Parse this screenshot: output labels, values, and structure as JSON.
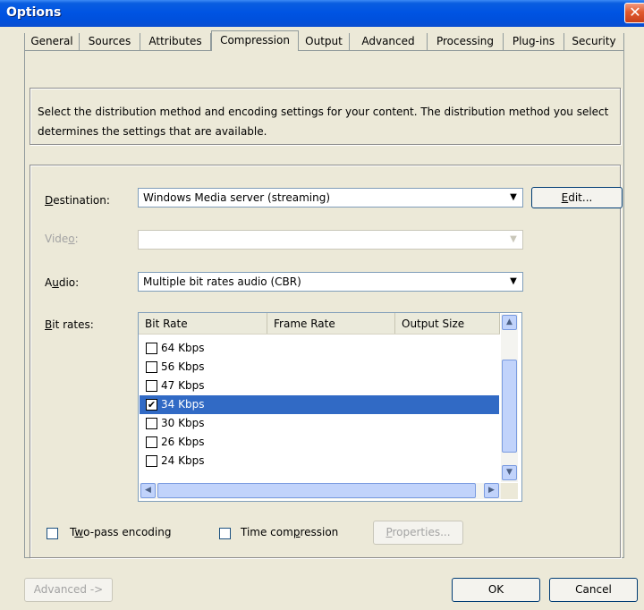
{
  "window": {
    "title": "Options",
    "close_glyph": "✕"
  },
  "tabs": [
    {
      "label": "General",
      "active": false
    },
    {
      "label": "Sources",
      "active": false
    },
    {
      "label": "Attributes",
      "active": false
    },
    {
      "label": "Compression",
      "active": true
    },
    {
      "label": "Output",
      "active": false
    },
    {
      "label": "Advanced",
      "active": false
    },
    {
      "label": "Processing",
      "active": false
    },
    {
      "label": "Plug-ins",
      "active": false
    },
    {
      "label": "Security",
      "active": false
    }
  ],
  "description": "Select the distribution method and encoding settings for your content. The distribution method you select determines the settings that are available.",
  "destination": {
    "label_pre": "",
    "label_key": "D",
    "label_post": "estination:",
    "value": "Windows Media server (streaming)",
    "edit_button_key": "E",
    "edit_button_post": "dit..."
  },
  "video": {
    "label_pre": "Vide",
    "label_key": "o",
    "label_post": ":",
    "value": "",
    "enabled": false
  },
  "audio": {
    "label_pre": "A",
    "label_key": "u",
    "label_post": "dio:",
    "value": "Multiple bit rates audio (CBR)"
  },
  "bitrates": {
    "label_pre": "",
    "label_key": "B",
    "label_post": "it rates:",
    "columns": [
      "Bit Rate",
      "Frame Rate",
      "Output Size"
    ],
    "rows": [
      {
        "label": "64 Kbps",
        "checked": false,
        "selected": false
      },
      {
        "label": "56 Kbps",
        "checked": false,
        "selected": false
      },
      {
        "label": "47 Kbps",
        "checked": false,
        "selected": false
      },
      {
        "label": "34 Kbps",
        "checked": true,
        "selected": true
      },
      {
        "label": "30 Kbps",
        "checked": false,
        "selected": false
      },
      {
        "label": "26 Kbps",
        "checked": false,
        "selected": false
      },
      {
        "label": "24 Kbps",
        "checked": false,
        "selected": false
      }
    ]
  },
  "options": {
    "two_pass_pre": "T",
    "two_pass_key": "w",
    "two_pass_post": "o-pass encoding",
    "two_pass_checked": false,
    "time_comp_pre": "Time com",
    "time_comp_key": "p",
    "time_comp_post": "ression",
    "time_comp_checked": false,
    "properties_key": "P",
    "properties_post": "roperties..."
  },
  "footer": {
    "advanced_label": "Advanced ->",
    "ok_label": "OK",
    "cancel_label": "Cancel"
  },
  "colors": {
    "titlebar": "#0054e3",
    "selection": "#316ac5",
    "dialog_bg": "#ece9d8"
  }
}
